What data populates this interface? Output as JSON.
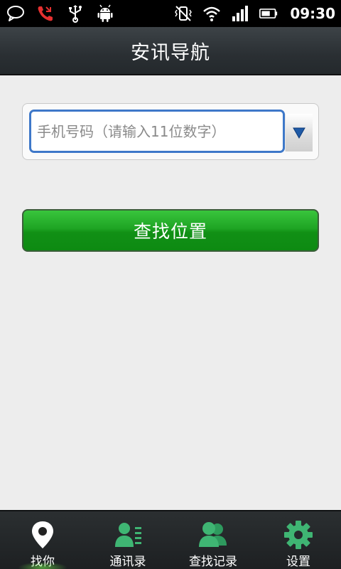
{
  "status_bar": {
    "time": "09:30",
    "icons": [
      "chat-bubble-icon",
      "missed-call-icon",
      "usb-icon",
      "android-icon",
      "vibrate-off-icon",
      "wifi-icon",
      "signal-icon",
      "battery-icon"
    ]
  },
  "header": {
    "title": "安讯导航"
  },
  "phone_input": {
    "value": "",
    "placeholder": "手机号码（请输入11位数字）"
  },
  "search_button": {
    "label": "查找位置"
  },
  "bottom_nav": {
    "active": "找你",
    "items": [
      {
        "label": "找你",
        "icon": "location-pin-icon"
      },
      {
        "label": "通讯录",
        "icon": "contacts-icon"
      },
      {
        "label": "查找记录",
        "icon": "search-history-icon"
      },
      {
        "label": "设置",
        "icon": "gear-icon"
      }
    ]
  },
  "colors": {
    "accent_green": "#1ea423",
    "input_border": "#3e78c9",
    "nav_icon_green": "#3fb573"
  }
}
